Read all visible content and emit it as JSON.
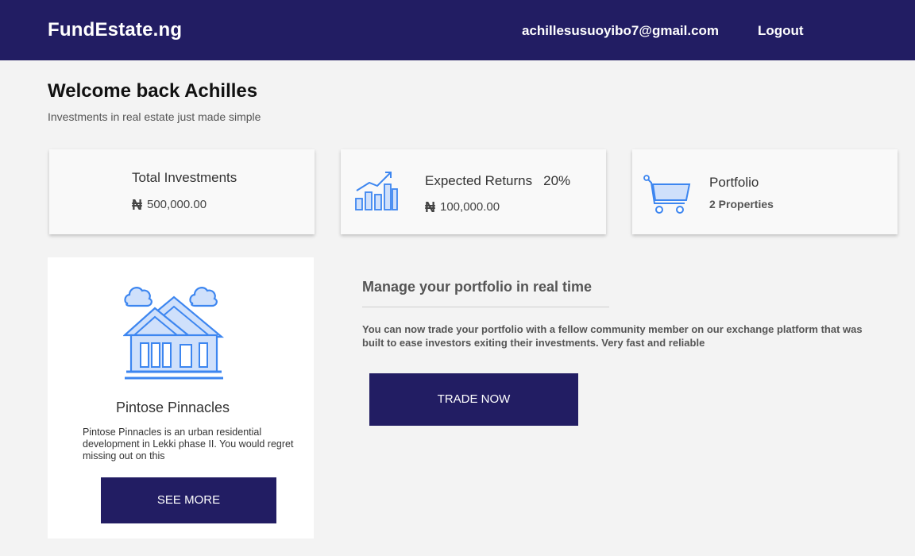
{
  "header": {
    "brand": "FundEstate.ng",
    "email": "achillesusuoyibo7@gmail.com",
    "logout": "Logout"
  },
  "welcome": {
    "title": "Welcome back Achilles",
    "subtitle": "Investments in real estate just made simple"
  },
  "cards": {
    "investments": {
      "title": "Total Investments",
      "value": "500,000.00",
      "icon": "money-bag-icon"
    },
    "returns": {
      "title": "Expected Returns",
      "percent": "20%",
      "value": "100,000.00",
      "icon": "growth-chart-icon"
    },
    "portfolio": {
      "title": "Portfolio",
      "value": "2 Properties",
      "icon": "cart-icon"
    }
  },
  "currency_symbol": "₦",
  "property": {
    "name": "Pintose Pinnacles",
    "description": "Pintose Pinnacles is an urban residential development in Lekki phase II. You would regret missing out on this",
    "button": "SEE MORE",
    "icon": "house-icon"
  },
  "manage": {
    "title": "Manage your portfolio in real time",
    "text": "You can now trade your portfolio  with a fellow community member on our exchange platform that was built to ease investors exiting their investments.  Very fast and reliable",
    "button": "TRADE NOW"
  },
  "colors": {
    "brand": "#221d63",
    "icon_blue": "#3d86f0",
    "icon_fill": "#cfe0fb",
    "background": "#f3f3f3"
  }
}
